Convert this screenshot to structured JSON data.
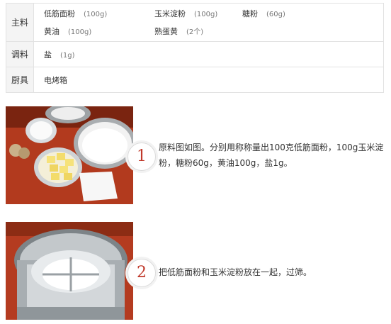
{
  "ingredients": {
    "main_label": "主料",
    "main_items": [
      {
        "name": "低筋面粉",
        "amount": "(100g)"
      },
      {
        "name": "玉米淀粉",
        "amount": "(100g)"
      },
      {
        "name": "糖粉",
        "amount": "(60g)"
      },
      {
        "name": "黄油",
        "amount": "(100g)"
      },
      {
        "name": "熟蛋黄",
        "amount": "(2个)"
      }
    ],
    "seasoning_label": "调料",
    "seasoning_items": [
      {
        "name": "盐",
        "amount": "(1g)"
      }
    ],
    "tools_label": "厨具",
    "tools_value": "电烤箱"
  },
  "steps": [
    {
      "number": "1",
      "text": "原料图如图。分别用称称量出100克低筋面粉，100g玉米淀粉，糖粉60g，黄油100g，盐1g。"
    },
    {
      "number": "2",
      "text": "把低筋面粉和玉米淀粉放在一起，过筛。"
    }
  ],
  "colors": {
    "number": "#c0392b",
    "border": "#e2e2e2"
  }
}
